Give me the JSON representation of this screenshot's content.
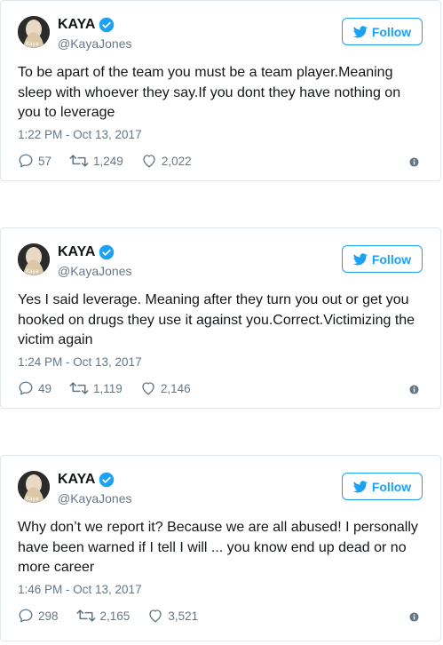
{
  "colors": {
    "accent": "#1da1f2",
    "muted": "#657786",
    "text": "#14171a",
    "border": "#e1e8ed"
  },
  "tweets": [
    {
      "name": "KAYA",
      "handle": "@KayaJones",
      "follow_label": "Follow",
      "text": "To be apart of the team you must be a team player.Meaning sleep with whoever they say.If you dont they have nothing on you to leverage",
      "timestamp": "1:22 PM - Oct 13, 2017",
      "replies": "57",
      "retweets": "1,249",
      "likes": "2,022"
    },
    {
      "name": "KAYA",
      "handle": "@KayaJones",
      "follow_label": "Follow",
      "text": "Yes I said leverage. Meaning after they turn you out or get you hooked on drugs they use it against you.Correct.Victimizing the victim again",
      "timestamp": "1:24 PM - Oct 13, 2017",
      "replies": "49",
      "retweets": "1,119",
      "likes": "2,146"
    },
    {
      "name": "KAYA",
      "handle": "@KayaJones",
      "follow_label": "Follow",
      "text": "Why don’t we report it? Because we are all abused! I personally have been warned if I tell I will ... you know end up dead or no more career",
      "timestamp": "1:46 PM - Oct 13, 2017",
      "replies": "298",
      "retweets": "2,165",
      "likes": "3,521"
    }
  ]
}
